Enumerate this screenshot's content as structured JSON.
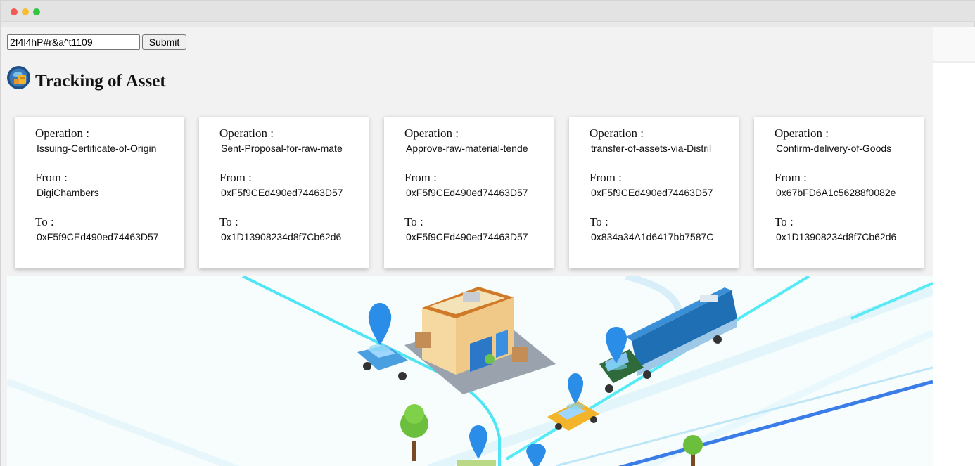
{
  "search": {
    "value": "2f4l4hP#r&a^t1109",
    "submit_label": "Submit"
  },
  "page": {
    "title": "Tracking of Asset",
    "logo_icon": "asset-globe-icon"
  },
  "labels": {
    "operation": "Operation :",
    "from": "From :",
    "to": "To :"
  },
  "cards": [
    {
      "operation": "Issuing-Certificate-of-Origin",
      "from": "DigiChambers",
      "to": "0xF5f9CEd490ed74463D57"
    },
    {
      "operation": "Sent-Proposal-for-raw-mate",
      "from": "0xF5f9CEd490ed74463D57",
      "to": "0x1D13908234d8f7Cb62d6"
    },
    {
      "operation": "Approve-raw-material-tende",
      "from": "0xF5f9CEd490ed74463D57",
      "to": "0xF5f9CEd490ed74463D57"
    },
    {
      "operation": "transfer-of-assets-via-Distril",
      "from": "0xF5f9CEd490ed74463D57",
      "to": "0x834a34A1d6417bb7587C"
    },
    {
      "operation": "Confirm-delivery-of-Goods",
      "from": "0x67bFD6A1c56288f0082e",
      "to": "0x1D13908234d8f7Cb62d6"
    }
  ],
  "colors": {
    "accent_road": "#4ee6f4",
    "truck": "#1e6fb3",
    "pin": "#2a8ee8"
  }
}
